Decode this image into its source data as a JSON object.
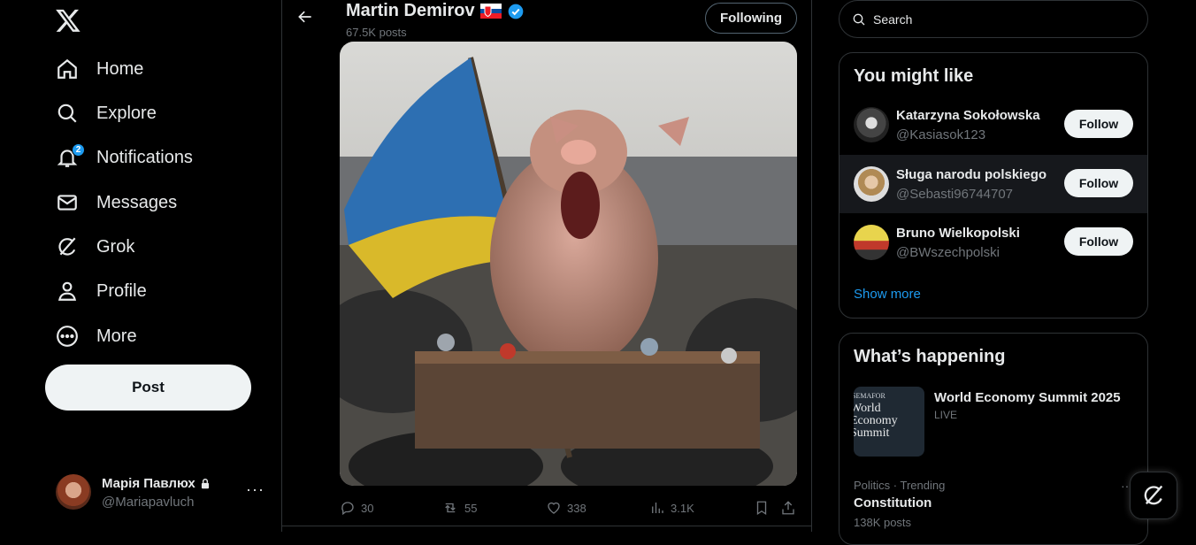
{
  "nav": {
    "items": [
      {
        "label": "Home",
        "icon": "home-icon"
      },
      {
        "label": "Explore",
        "icon": "search-icon"
      },
      {
        "label": "Notifications",
        "icon": "bell-icon",
        "badge": "2"
      },
      {
        "label": "Messages",
        "icon": "envelope-icon"
      },
      {
        "label": "Grok",
        "icon": "grok-icon"
      },
      {
        "label": "Profile",
        "icon": "person-icon"
      },
      {
        "label": "More",
        "icon": "more-circle-icon"
      }
    ],
    "post_label": "Post"
  },
  "account": {
    "name": "Марія Павлюх",
    "handle": "@Mariapavluch"
  },
  "post": {
    "author": "Martin Demirov",
    "posts_count": "67.5K posts",
    "following_label": "Following",
    "replies": "30",
    "reposts": "55",
    "likes": "338",
    "views": "3.1K"
  },
  "search": {
    "placeholder": "Search"
  },
  "suggestions": {
    "title": "You might like",
    "follow_label": "Follow",
    "users": [
      {
        "name": "Katarzyna Sokołowska",
        "handle": "@Kasiasok123"
      },
      {
        "name": "Sługa narodu polskiego",
        "handle": "@Sebasti96744707"
      },
      {
        "name": "Bruno Wielkopolski",
        "handle": "@BWszechpolski"
      }
    ],
    "show_more": "Show more"
  },
  "happening": {
    "title": "What’s happening",
    "event": {
      "title": "World Economy Summit 2025",
      "status": "LIVE",
      "thumb_text": "World Economy Summit",
      "thumb_brand": "SEMAFOR"
    },
    "trend": {
      "category": "Politics · Trending",
      "name": "Constitution",
      "count": "138K posts"
    }
  },
  "colors": {
    "accent": "#1d9bf0",
    "background": "#000000",
    "border": "#2f3336",
    "muted": "#71767b"
  }
}
